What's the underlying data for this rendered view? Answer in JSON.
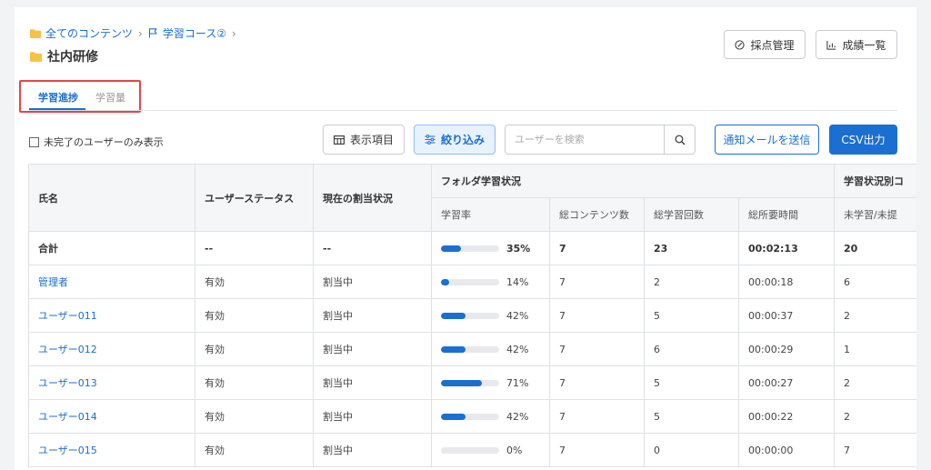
{
  "breadcrumb": {
    "root": "全てのコンテンツ",
    "course": "学習コース②"
  },
  "page_title": "社内研修",
  "header_buttons": {
    "grading": "採点管理",
    "grades": "成績一覧"
  },
  "tabs": [
    {
      "label": "学習進捗",
      "active": true
    },
    {
      "label": "学習量",
      "active": false
    }
  ],
  "toolbar": {
    "incomplete_only_label": "未完了のユーザーのみ表示",
    "columns_label": "表示項目",
    "filter_label": "絞り込み",
    "search_placeholder": "ユーザーを検索",
    "mail_label": "通知メールを送信",
    "csv_label": "CSV出力"
  },
  "table": {
    "headers": {
      "name": "氏名",
      "user_status": "ユーザーステータス",
      "assignment": "現在の割当状況",
      "folder_group": "フォルダ学習状況",
      "status_group": "学習状況別コ",
      "rate": "学習率",
      "total_contents": "総コンテンツ数",
      "total_sessions": "総学習回数",
      "total_time": "総所要時間",
      "unlearned": "未学習/未提"
    },
    "total_row": {
      "name": "合計",
      "status": "--",
      "assignment": "--",
      "rate": 35,
      "rate_label": "35%",
      "contents": "7",
      "sessions": "23",
      "time": "00:02:13",
      "unlearned": "20"
    },
    "rows": [
      {
        "name": "管理者",
        "status": "有効",
        "assignment": "割当中",
        "rate": 14,
        "rate_label": "14%",
        "contents": "7",
        "sessions": "2",
        "time": "00:00:18",
        "unlearned": "6"
      },
      {
        "name": "ユーザー011",
        "status": "有効",
        "assignment": "割当中",
        "rate": 42,
        "rate_label": "42%",
        "contents": "7",
        "sessions": "5",
        "time": "00:00:37",
        "unlearned": "2"
      },
      {
        "name": "ユーザー012",
        "status": "有効",
        "assignment": "割当中",
        "rate": 42,
        "rate_label": "42%",
        "contents": "7",
        "sessions": "6",
        "time": "00:00:29",
        "unlearned": "1"
      },
      {
        "name": "ユーザー013",
        "status": "有効",
        "assignment": "割当中",
        "rate": 71,
        "rate_label": "71%",
        "contents": "7",
        "sessions": "5",
        "time": "00:00:27",
        "unlearned": "2"
      },
      {
        "name": "ユーザー014",
        "status": "有効",
        "assignment": "割当中",
        "rate": 42,
        "rate_label": "42%",
        "contents": "7",
        "sessions": "5",
        "time": "00:00:22",
        "unlearned": "2"
      },
      {
        "name": "ユーザー015",
        "status": "有効",
        "assignment": "割当中",
        "rate": 0,
        "rate_label": "0%",
        "contents": "7",
        "sessions": "0",
        "time": "00:00:00",
        "unlearned": "7"
      }
    ]
  },
  "icons": {
    "folder": "folder-icon",
    "flag": "flag-icon",
    "chevron": "chevron-right-icon",
    "grading": "grading-icon",
    "grades": "chart-icon",
    "columns": "table-columns-icon",
    "filter": "filter-sliders-icon",
    "search": "search-icon"
  },
  "colors": {
    "accent": "#1a6fd1",
    "folder": "#f5c242",
    "highlight_box": "#e6434b"
  }
}
